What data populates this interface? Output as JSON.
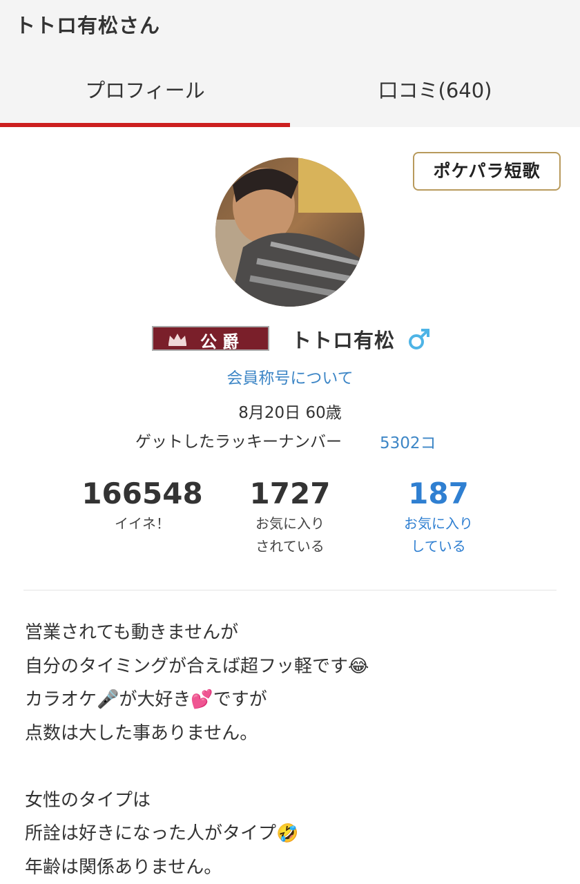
{
  "header": {
    "title": "トトロ有松さん",
    "tabs": [
      {
        "label": "プロフィール",
        "active": true
      },
      {
        "label": "口コミ(640)",
        "active": false
      }
    ],
    "active_color": "#cc1f1f"
  },
  "profile": {
    "tanka_button": "ポケパラ短歌",
    "rank_badge": "公爵",
    "name": "トトロ有松",
    "gender_icon": "male-icon",
    "member_title_link": "会員称号について",
    "birthday_age": "8月20日 60歳",
    "lucky_number_label": "ゲットしたラッキーナンバー",
    "lucky_number_value": "5302コ",
    "link_color": "#3d86c6"
  },
  "stats": {
    "likes": {
      "value": "166548",
      "label": "イイネ！"
    },
    "favorited": {
      "value": "1727",
      "label_line1": "お気に入り",
      "label_line2": "されている"
    },
    "favoriting": {
      "value": "187",
      "label_line1": "お気に入り",
      "label_line2": "している"
    }
  },
  "bio": {
    "lines": [
      {
        "text": "営業されても動きませんが",
        "emoji": ""
      },
      {
        "text": "自分のタイミングが合えば超フッ軽です",
        "emoji": "😂"
      },
      {
        "parts": [
          "カラオケ",
          "🎤",
          "が大好き",
          "💕",
          "ですが"
        ]
      },
      {
        "text": "点数は大した事ありません。",
        "emoji": ""
      },
      {
        "text": "",
        "emoji": ""
      },
      {
        "text": "女性のタイプは",
        "emoji": ""
      },
      {
        "text": "所詮は好きになった人がタイプ",
        "emoji": "🤣"
      },
      {
        "text": "年齢は関係ありません。",
        "emoji": ""
      }
    ]
  }
}
